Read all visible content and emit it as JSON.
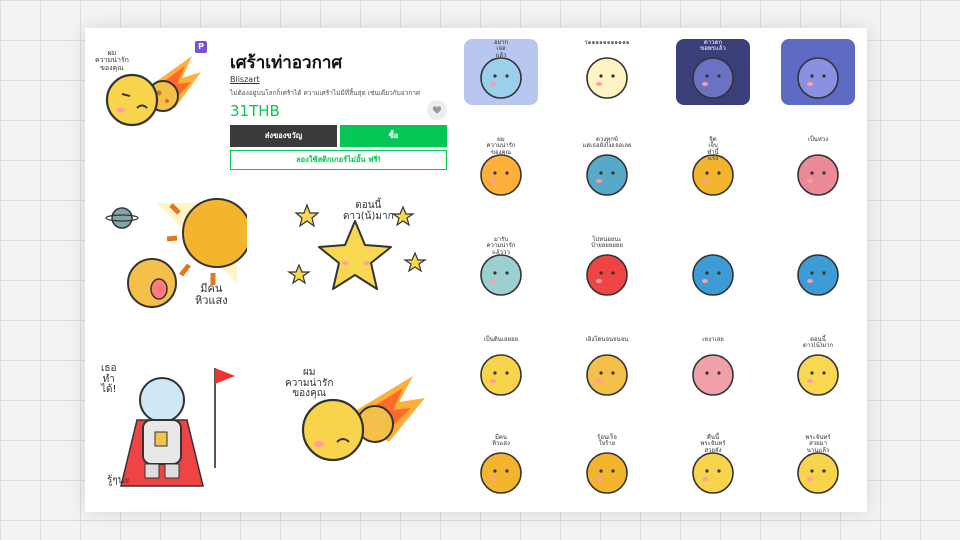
{
  "product": {
    "title": "เศร้าเท่าอวกาศ",
    "author": "Bliszart",
    "description": "ไม่ต้องอยู่บนโลกก็เศร้าได้ ความเศร้าไม่มีที่สิ้นสุด เช่นเดียวกับอวกาศ",
    "price": "31THB",
    "premium_badge": "P"
  },
  "buttons": {
    "gift": "ส่งของขวัญ",
    "buy": "ซื้อ",
    "try": "ลองใช้สติกเกอร์ไม่อั้น ฟรี!"
  },
  "icons": {
    "favorite": "heart-icon",
    "premium": "premium-badge-icon"
  },
  "colors": {
    "accent": "#06c755",
    "dark_button": "#3a3a3a",
    "badge": "#7b4fd6",
    "price": "#06c755"
  },
  "preview_captions": {
    "main": "ผม\nความน่ารัก\nของคุณ",
    "big1": "มีคน\nหิวแสง",
    "big2": "ตอนนี้\nดาว(น้)มาก",
    "big3_top": "เธอ\nทำ\nได้!",
    "big3_bottom": "รู้ๆนะ",
    "big4": "ผม\nความน่ารัก\nของคุณ"
  },
  "sticker_captions": [
    "อยาก\nเจอ\nแล้ว",
    "ร๑๑๑๑๑๑๑๑๑๑๑",
    "ดาวตก\nขอพรแล้ว",
    "",
    "ผม\nความน่ารัก\nของคุณ",
    "ดวงทุกข์\nแต่เธอยังไม่เจอเลย",
    "จิต\nเจ็บ\nทำนี้\nแรง",
    "เป็นห่วง",
    "มารับ\nความน่ารัก\nแล้ววว",
    "ไปหน่อยนะ\nบ้ายยยยยยย",
    "",
    "",
    "เป็นดินเลยยย",
    "เอิงโดนจนจนจน",
    "เหงาเลย",
    "ตอนนี้\nดาว(น้)มาก",
    "มีคน\nหิวแสง",
    "ร้อนเร็จ\nใจร้าย",
    "คืนนี้\nพระจันทร์\nสวยจัง",
    "พระจันทร์\nสวยมา\nนานแล้ว"
  ]
}
